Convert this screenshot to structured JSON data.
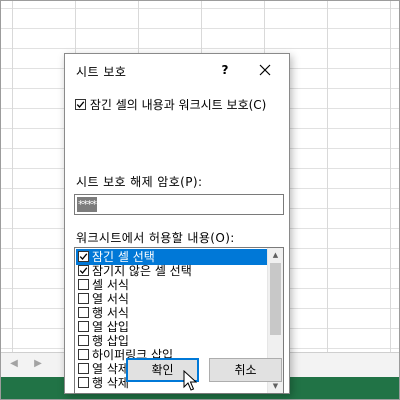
{
  "dialog": {
    "title": "시트 보호",
    "help_label": "?",
    "protect_option": {
      "label": "잠긴 셀의 내용과 워크시트 보호(C)",
      "checked": true
    },
    "password_label": "시트 보호 해제 암호(P):",
    "password_value": "****",
    "list_label": "워크시트에서 허용할 내용(O):",
    "list_items": [
      {
        "label": "잠긴 셀 선택",
        "checked": true,
        "selected": true
      },
      {
        "label": "잠기지 않은 셀 선택",
        "checked": true,
        "selected": false
      },
      {
        "label": "셀 서식",
        "checked": false,
        "selected": false
      },
      {
        "label": "열 서식",
        "checked": false,
        "selected": false
      },
      {
        "label": "행 서식",
        "checked": false,
        "selected": false
      },
      {
        "label": "열 삽입",
        "checked": false,
        "selected": false
      },
      {
        "label": "행 삽입",
        "checked": false,
        "selected": false
      },
      {
        "label": "하이퍼링크 삽입",
        "checked": false,
        "selected": false
      },
      {
        "label": "열 삭제",
        "checked": false,
        "selected": false
      },
      {
        "label": "행 삭제",
        "checked": false,
        "selected": false
      }
    ],
    "ok_label": "확인",
    "cancel_label": "취소"
  },
  "icons": {
    "help": "help-icon",
    "close": "close-icon",
    "scroll_up": "scroll-up-icon",
    "scroll_down": "scroll-down-icon",
    "cursor": "mouse-cursor-icon"
  },
  "colors": {
    "selection": "#0078d7",
    "status_bar": "#217346",
    "default_button_border": "#0078d7"
  }
}
